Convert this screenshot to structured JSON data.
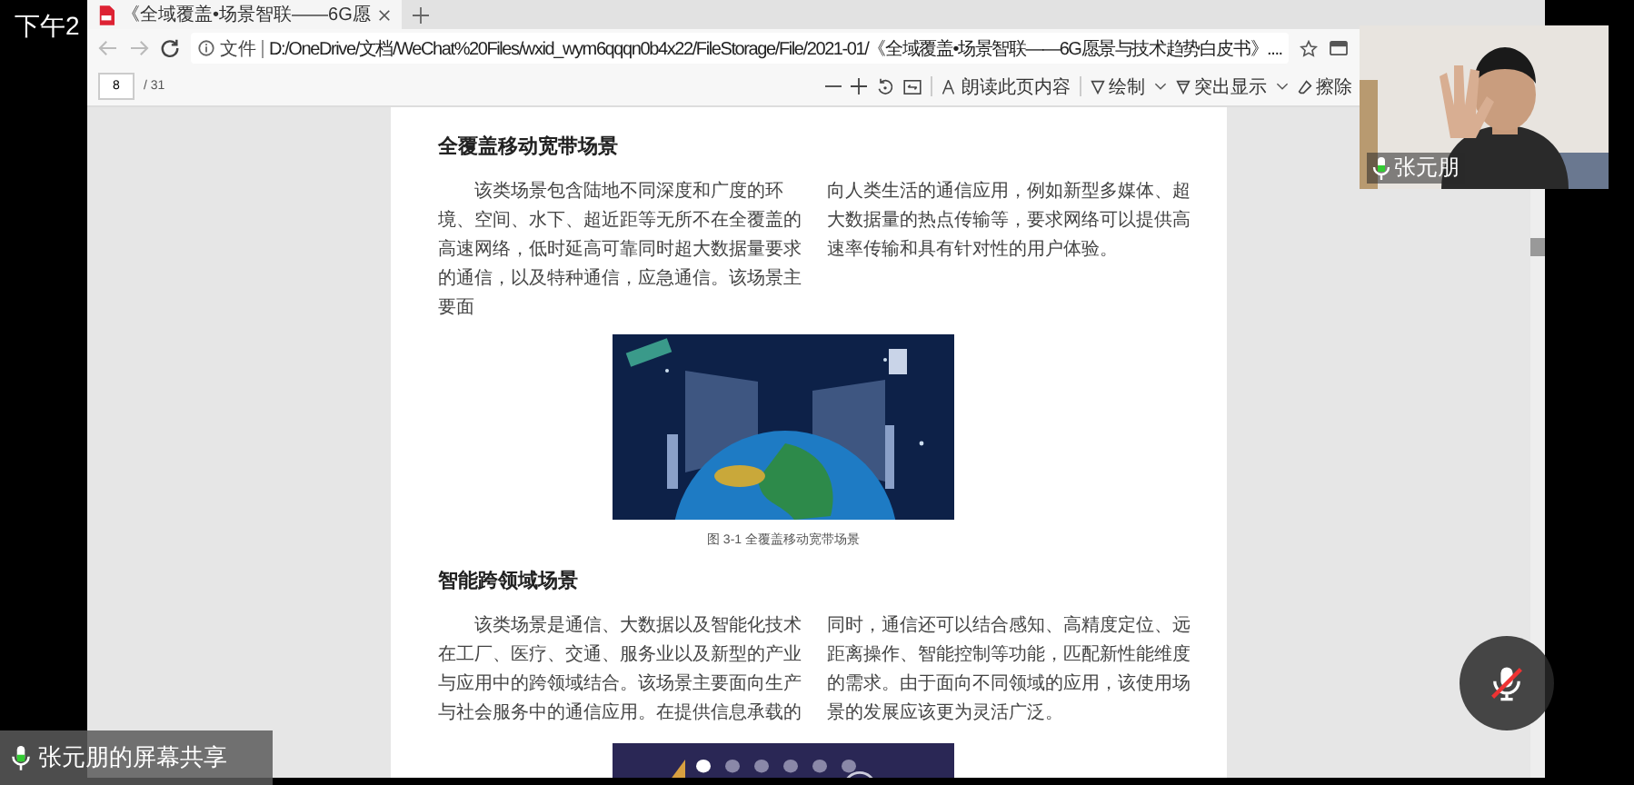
{
  "clock": {
    "time": "下午2"
  },
  "browser": {
    "tab": {
      "title": "《全域覆盖•场景智联——6G愿"
    },
    "address": {
      "label": "文件",
      "url": "D:/OneDrive/文档/WeChat%20Files/wxid_wym6qqqn0b4x22/FileStorage/File/2021-01/《全域覆盖•场景智联——6G愿景与技术趋势白皮书》...."
    },
    "pdf_toolbar": {
      "page": "8",
      "page_count": "/ 31",
      "read_aloud": "朗读此页内容",
      "draw": "绘制",
      "highlight": "突出显示",
      "erase": "擦除"
    }
  },
  "document": {
    "sections": [
      {
        "heading": "全覆盖移动宽带场景",
        "columns": [
          "该类场景包含陆地不同深度和广度的环境、空间、水下、超近距等无所不在全覆盖的高速网络，低时延高可靠同时超大数据量要求的通信，以及特种通信，应急通信。该场景主要面",
          "向人类生活的通信应用，例如新型多媒体、超大数据量的热点传输等，要求网络可以提供高速率传输和具有针对性的用户体验。"
        ],
        "figure": {
          "kind": "picture",
          "caption": "图 3-1 全覆盖移动宽带场景"
        }
      },
      {
        "heading": "智能跨领域场景",
        "columns": [
          "该类场景是通信、大数据以及智能化技术在工厂、医疗、交通、服务业以及新型的产业与应用中的跨领域结合。该场景主要面向生产与社会服务中的通信应用。在提供信息承载的",
          "同时，通信还可以结合感知、高精度定位、远距离操作、智能控制等功能，匹配新性能维度的需求。由于面向不同领域的应用，该使用场景的发展应该更为灵活广泛。"
        ]
      }
    ]
  },
  "video_call": {
    "participant": {
      "name": "张元朋"
    },
    "screen_share": {
      "label": "张元朋的屏幕共享"
    },
    "mute_button": {
      "muted": true
    }
  }
}
